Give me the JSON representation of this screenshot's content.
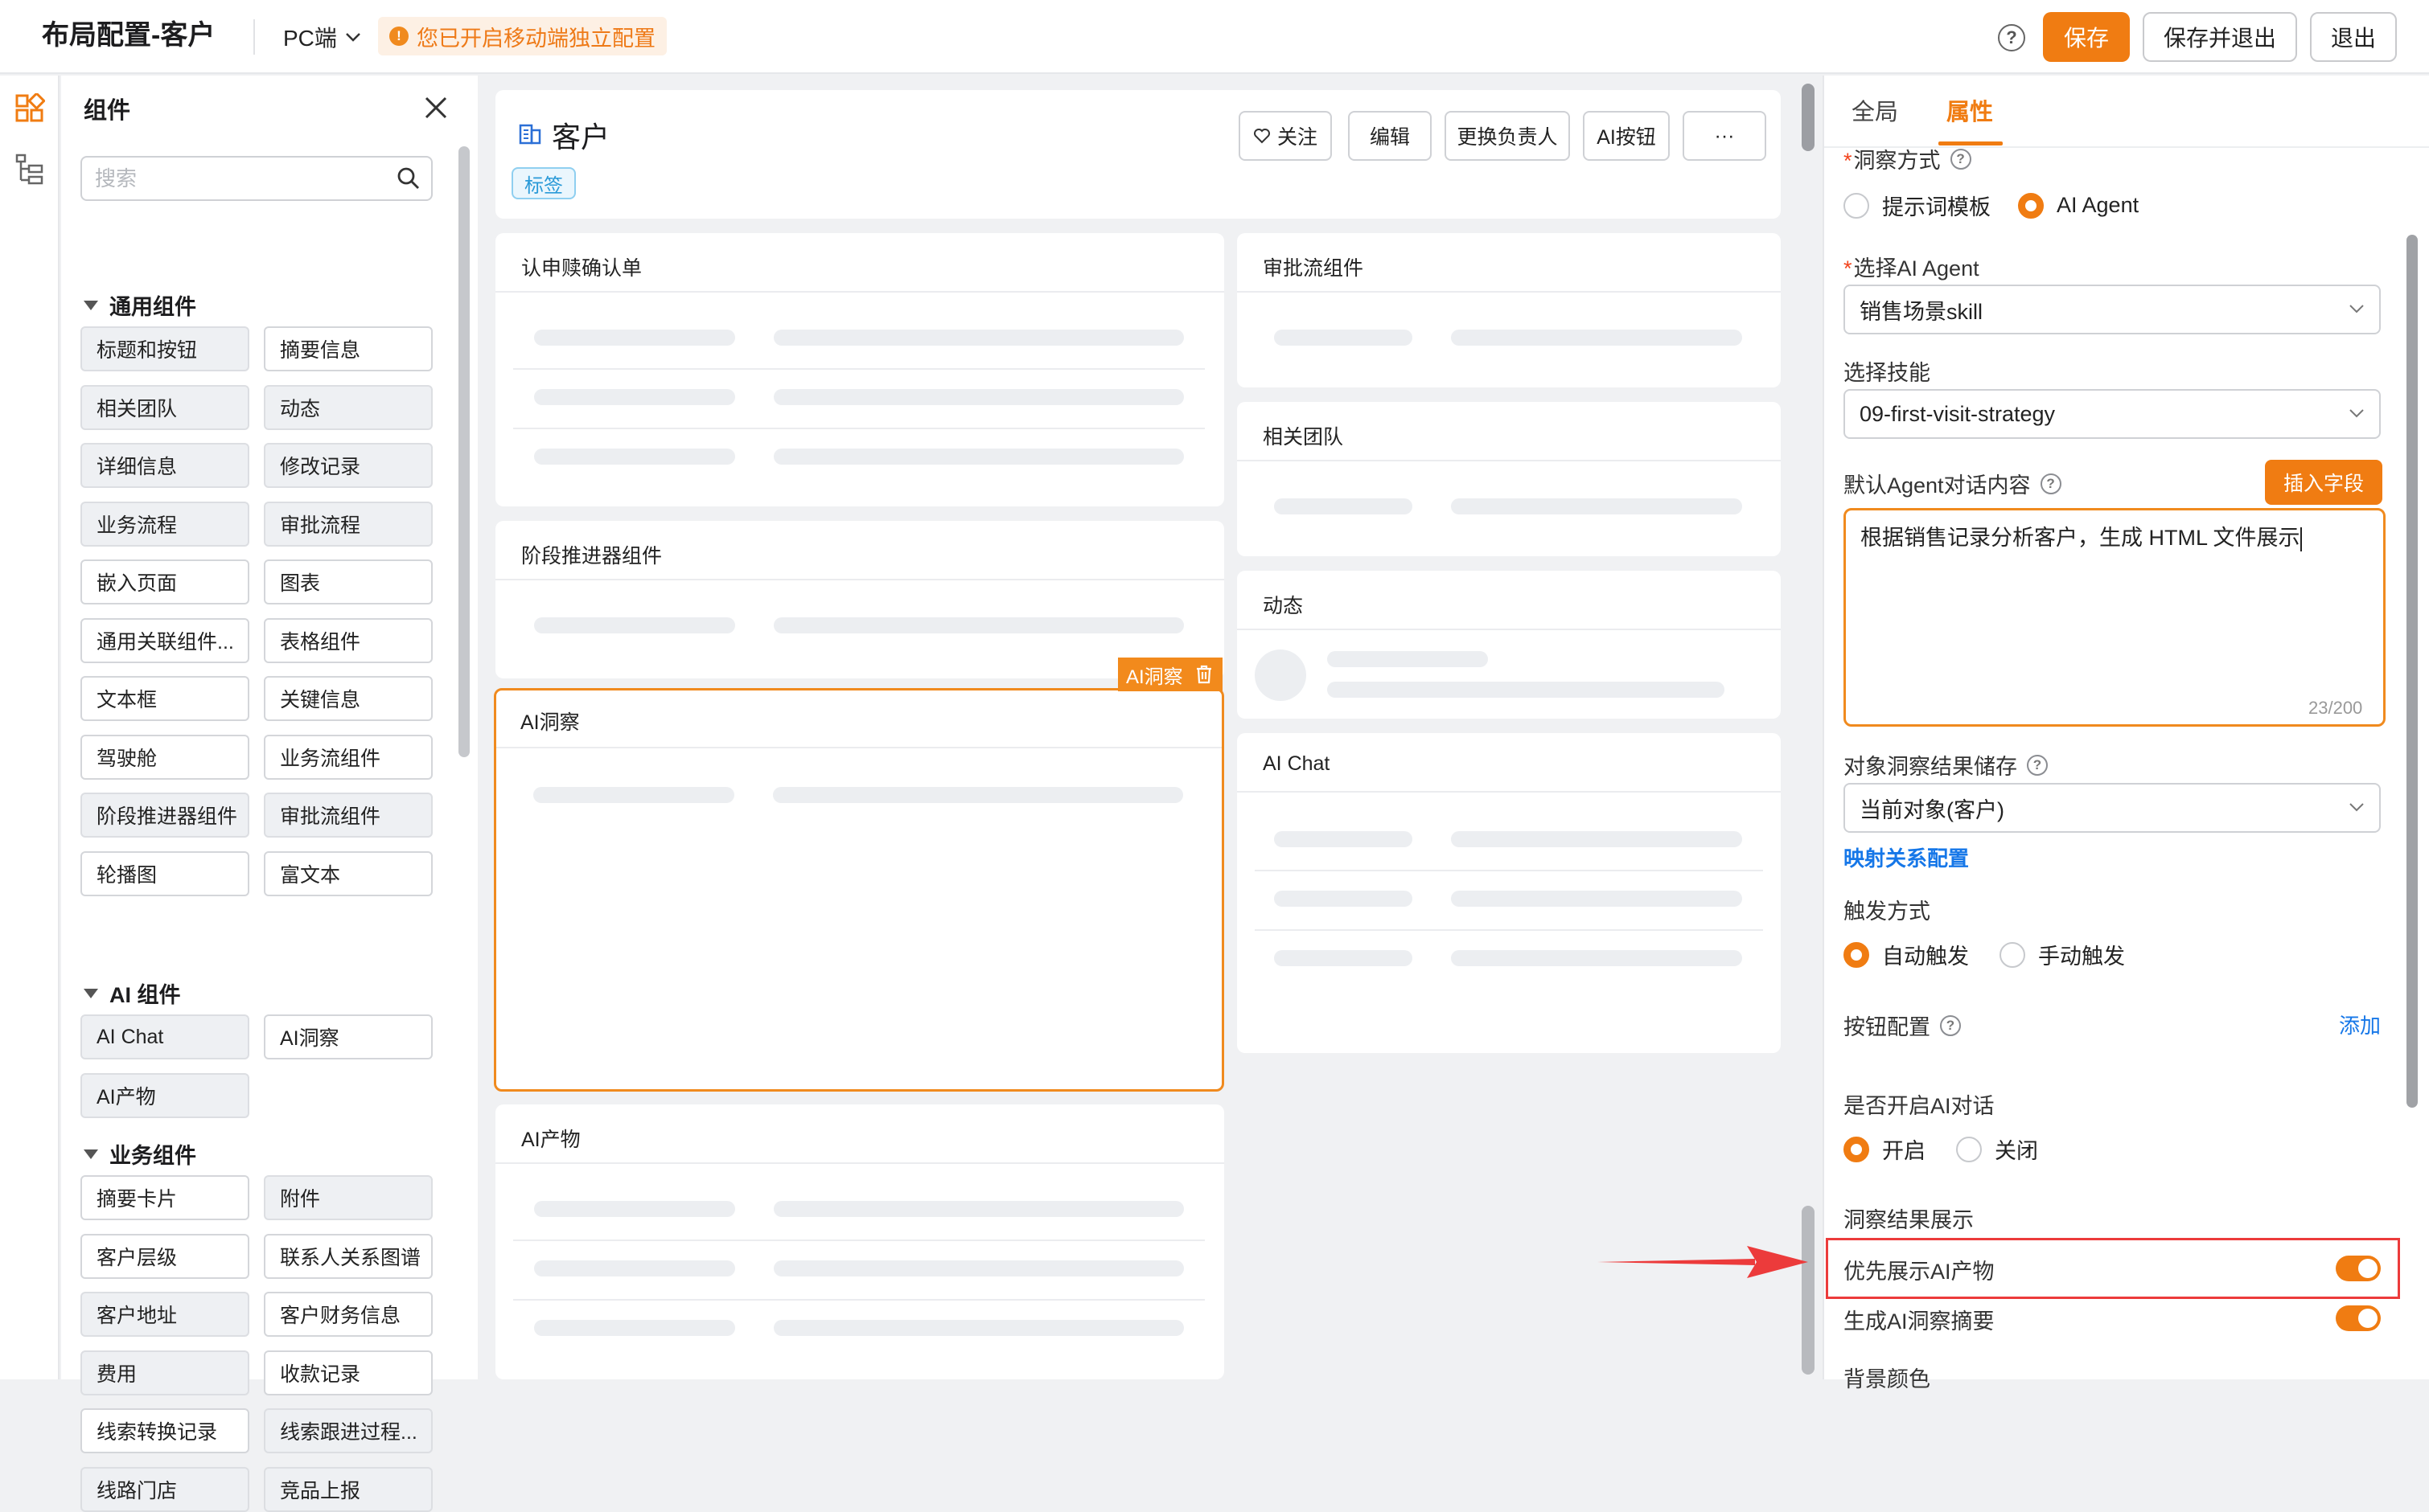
{
  "header": {
    "title": "布局配置-客户",
    "device": "PC端",
    "notice": "您已开启移动端独立配置",
    "buttons": {
      "save": "保存",
      "save_exit": "保存并退出",
      "exit": "退出"
    }
  },
  "components": {
    "title": "组件",
    "search_placeholder": "搜索",
    "groups": [
      {
        "title": "通用组件",
        "items": [
          {
            "label": "标题和按钮",
            "used": true
          },
          {
            "label": "摘要信息",
            "used": false
          },
          {
            "label": "相关团队",
            "used": true
          },
          {
            "label": "动态",
            "used": true
          },
          {
            "label": "详细信息",
            "used": true
          },
          {
            "label": "修改记录",
            "used": true
          },
          {
            "label": "业务流程",
            "used": true
          },
          {
            "label": "审批流程",
            "used": true
          },
          {
            "label": "嵌入页面",
            "used": false
          },
          {
            "label": "图表",
            "used": false
          },
          {
            "label": "通用关联组件...",
            "used": false
          },
          {
            "label": "表格组件",
            "used": false
          },
          {
            "label": "文本框",
            "used": false
          },
          {
            "label": "关键信息",
            "used": false
          },
          {
            "label": "驾驶舱",
            "used": false
          },
          {
            "label": "业务流组件",
            "used": false
          },
          {
            "label": "阶段推进器组件",
            "used": true
          },
          {
            "label": "审批流组件",
            "used": true
          },
          {
            "label": "轮播图",
            "used": false
          },
          {
            "label": "富文本",
            "used": false
          }
        ]
      },
      {
        "title": "AI 组件",
        "items": [
          {
            "label": "AI Chat",
            "used": true
          },
          {
            "label": "AI洞察",
            "used": false
          },
          {
            "label": "AI产物",
            "used": true
          }
        ]
      },
      {
        "title": "业务组件",
        "items": [
          {
            "label": "摘要卡片",
            "used": false
          },
          {
            "label": "附件",
            "used": true
          },
          {
            "label": "客户层级",
            "used": false
          },
          {
            "label": "联系人关系图谱",
            "used": false
          },
          {
            "label": "客户地址",
            "used": true
          },
          {
            "label": "客户财务信息",
            "used": false
          },
          {
            "label": "费用",
            "used": true
          },
          {
            "label": "收款记录",
            "used": false
          },
          {
            "label": "线索转换记录",
            "used": false
          },
          {
            "label": "线索跟进过程...",
            "used": true
          },
          {
            "label": "线路门店",
            "used": true
          },
          {
            "label": "竞品上报",
            "used": true
          }
        ]
      }
    ]
  },
  "canvas": {
    "object_name": "客户",
    "tag": "标签",
    "buttons": {
      "follow": "关注",
      "edit": "编辑",
      "change_owner": "更换负责人",
      "ai_button": "AI按钮",
      "more": "···"
    },
    "cards": {
      "recognition": "认申赎确认单",
      "stage": "阶段推进器组件",
      "ai_insight": "AI洞察",
      "ai_product": "AI产物",
      "approval": "审批流组件",
      "team": "相关团队",
      "activity": "动态",
      "ai_chat": "AI Chat"
    },
    "selected_toolbar_label": "AI洞察"
  },
  "properties": {
    "tabs": {
      "global": "全局",
      "props": "属性"
    },
    "insight_mode": {
      "label": "洞察方式",
      "options": [
        "提示词模板",
        "AI Agent"
      ],
      "selected": "AI Agent"
    },
    "select_agent": {
      "label": "选择AI Agent",
      "value": "销售场景skill"
    },
    "select_skill": {
      "label": "选择技能",
      "value": "09-first-visit-strategy"
    },
    "default_content": {
      "label": "默认Agent对话内容",
      "insert_button": "插入字段",
      "value": "根据销售记录分析客户，生成 HTML 文件展示",
      "count": "23/200"
    },
    "storage": {
      "label": "对象洞察结果储存",
      "value": "当前对象(客户)",
      "mapping_link": "映射关系配置"
    },
    "trigger": {
      "label": "触发方式",
      "options": [
        "自动触发",
        "手动触发"
      ],
      "selected": "自动触发"
    },
    "button_config": {
      "label": "按钮配置",
      "add": "添加"
    },
    "ai_chat_enabled": {
      "label": "是否开启AI对话",
      "options": [
        "开启",
        "关闭"
      ],
      "selected": "开启"
    },
    "result_display": {
      "label": "洞察结果展示",
      "prefer_ai_product": {
        "label": "优先展示AI产物",
        "on": true
      },
      "generate_summary": {
        "label": "生成AI洞察摘要",
        "on": true
      }
    },
    "background_color": {
      "label": "背景颜色"
    }
  },
  "colors": {
    "accent": "#f07c12",
    "link": "#1677e8",
    "highlight": "#ec3b3b"
  }
}
